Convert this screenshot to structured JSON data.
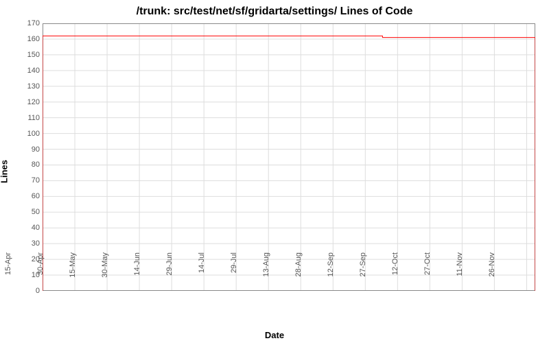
{
  "chart_data": {
    "type": "line",
    "title": "/trunk: src/test/net/sf/gridarta/settings/ Lines of Code",
    "xlabel": "Date",
    "ylabel": "Lines",
    "ylim": [
      0,
      170
    ],
    "yticks": [
      0,
      10,
      20,
      30,
      40,
      50,
      60,
      70,
      80,
      90,
      100,
      110,
      120,
      130,
      140,
      150,
      160,
      170
    ],
    "categories": [
      "15-Apr",
      "30-Apr",
      "15-May",
      "30-May",
      "14-Jun",
      "29-Jun",
      "14-Jul",
      "29-Jul",
      "13-Aug",
      "28-Aug",
      "12-Sep",
      "27-Sep",
      "12-Oct",
      "27-Oct",
      "11-Nov",
      "26-Nov"
    ],
    "series": [
      {
        "name": "Lines of Code",
        "color": "#ff0000",
        "points": [
          {
            "x": "15-Apr",
            "y": 0
          },
          {
            "x": "15-Apr",
            "y": 162
          },
          {
            "x": "20-Sep",
            "y": 162
          },
          {
            "x": "20-Sep",
            "y": 161
          },
          {
            "x": "30-Nov",
            "y": 161
          },
          {
            "x": "30-Nov",
            "y": 0
          }
        ]
      }
    ]
  }
}
